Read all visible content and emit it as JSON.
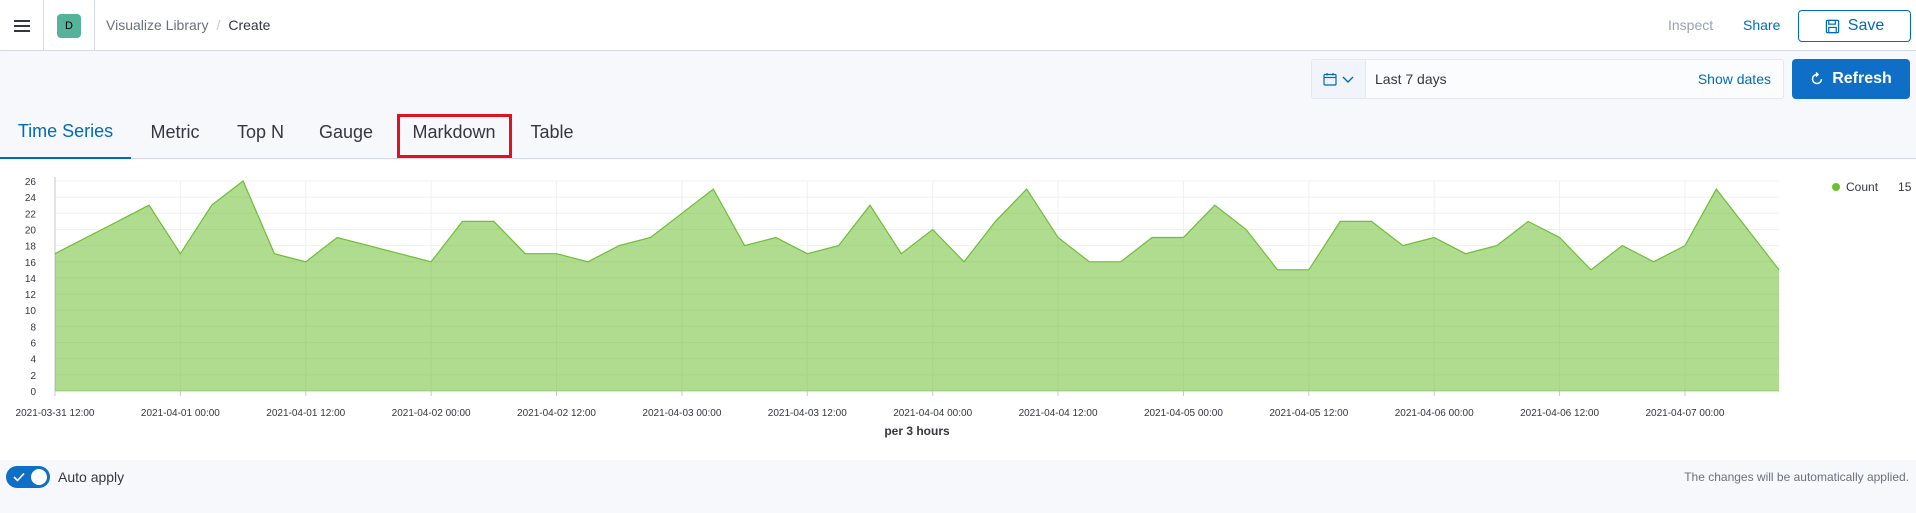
{
  "header": {
    "space_initial": "D",
    "breadcrumbs": [
      "Visualize Library",
      "Create"
    ],
    "inspect_label": "Inspect",
    "share_label": "Share",
    "save_label": "Save"
  },
  "query_bar": {
    "date_range": "Last 7 days",
    "show_dates_label": "Show dates",
    "refresh_label": "Refresh"
  },
  "tabs": [
    "Time Series",
    "Metric",
    "Top N",
    "Gauge",
    "Markdown",
    "Table"
  ],
  "active_tab": "Time Series",
  "highlighted_tab": "Markdown",
  "colors": {
    "accent": "#006bb8",
    "series": "#6dbf32",
    "highlight": "#e0121f"
  },
  "legend": {
    "label": "Count",
    "value": "15"
  },
  "chart_data": {
    "type": "area",
    "xlabel": "per 3 hours",
    "ylabel": "",
    "ylim": [
      0,
      26
    ],
    "y_ticks": [
      0,
      2,
      4,
      6,
      8,
      10,
      12,
      14,
      16,
      18,
      20,
      22,
      24,
      26
    ],
    "x_ticks": [
      "2021-03-31 12:00",
      "2021-04-01 00:00",
      "2021-04-01 12:00",
      "2021-04-02 00:00",
      "2021-04-02 12:00",
      "2021-04-03 00:00",
      "2021-04-03 12:00",
      "2021-04-04 00:00",
      "2021-04-04 12:00",
      "2021-04-05 00:00",
      "2021-04-05 12:00",
      "2021-04-06 00:00",
      "2021-04-06 12:00",
      "2021-04-07 00:00"
    ],
    "series": [
      {
        "name": "Count",
        "x_start": "2021-03-31 12:00",
        "x_step_hours": 3,
        "values": [
          17,
          19,
          21,
          23,
          17,
          23,
          26,
          17,
          16,
          19,
          18,
          17,
          16,
          21,
          21,
          17,
          17,
          16,
          18,
          19,
          22,
          25,
          18,
          19,
          17,
          18,
          23,
          17,
          20,
          16,
          21,
          25,
          19,
          16,
          16,
          19,
          19,
          23,
          20,
          15,
          15,
          21,
          21,
          18,
          19,
          17,
          18,
          21,
          19,
          15,
          18,
          16,
          18,
          25,
          20,
          15
        ]
      }
    ]
  },
  "bottom": {
    "auto_apply_label": "Auto apply",
    "auto_apply_note": "The changes will be automatically applied."
  }
}
